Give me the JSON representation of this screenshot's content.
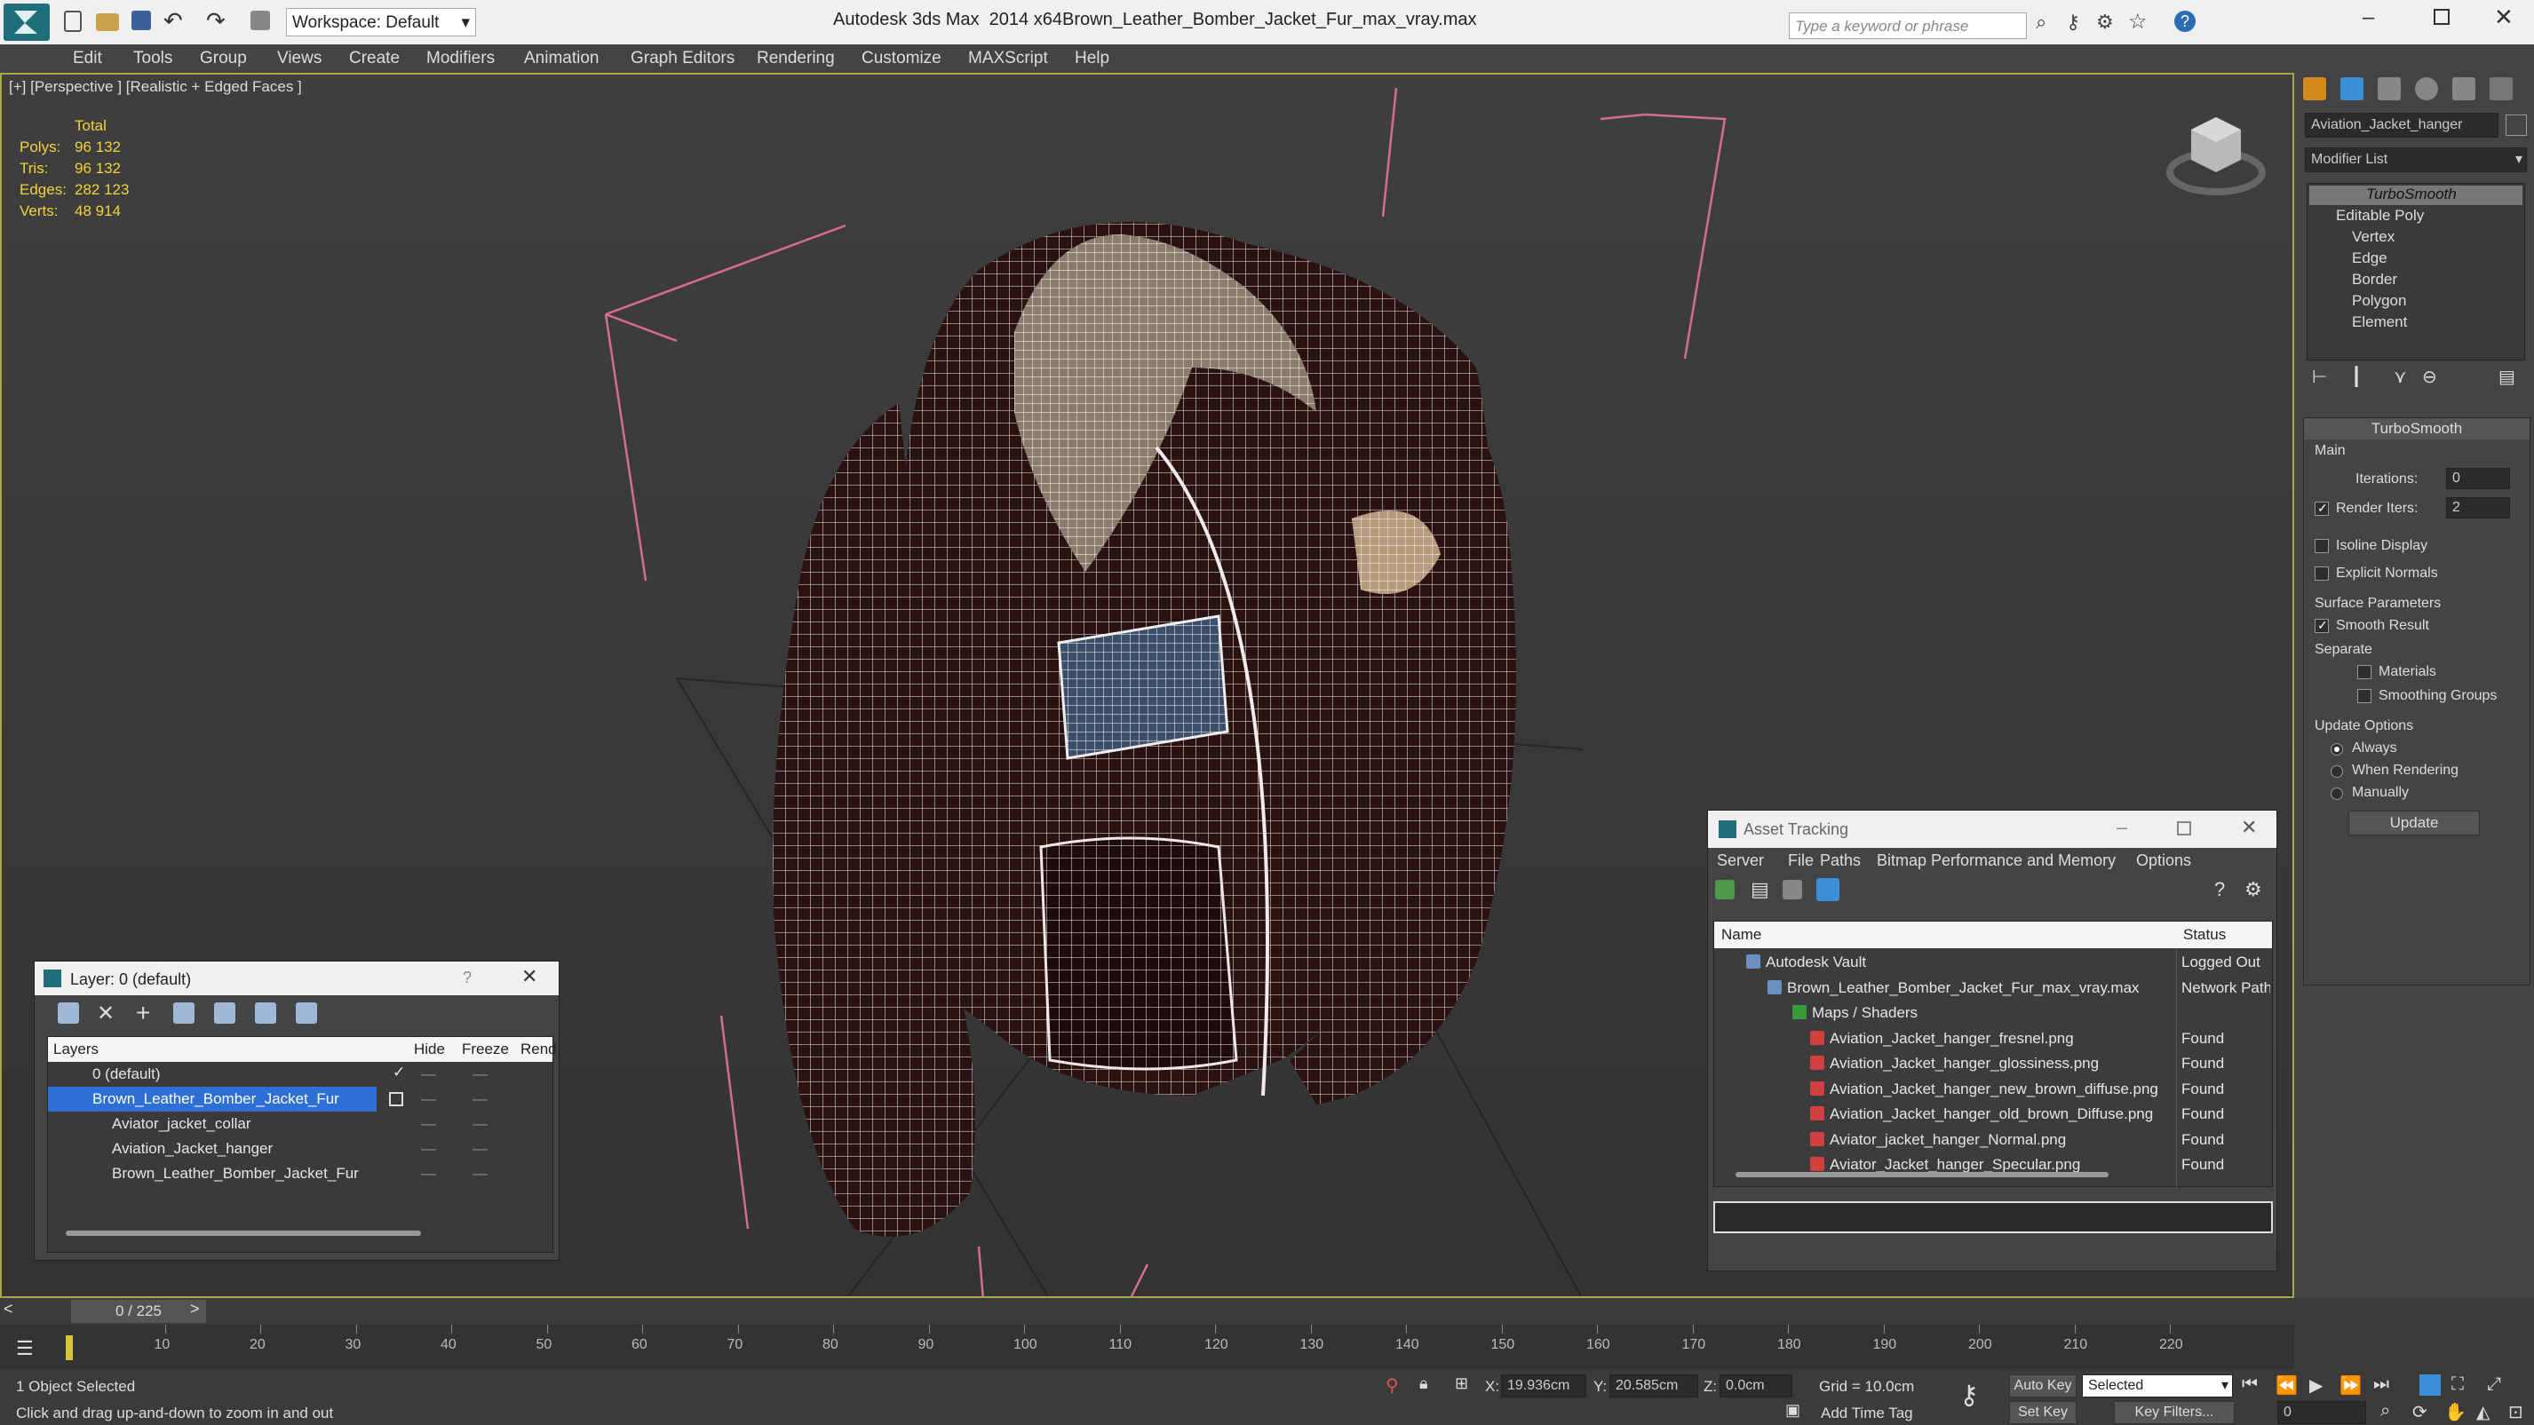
{
  "title_bar": {
    "app": "Autodesk 3ds Max  2014 x64",
    "file": "Brown_Leather_Bomber_Jacket_Fur_max_vray.max",
    "workspace": "Workspace: Default",
    "search_placeholder": "Type a keyword or phrase"
  },
  "menu": [
    "Edit",
    "Tools",
    "Group",
    "Views",
    "Create",
    "Modifiers",
    "Animation",
    "Graph Editors",
    "Rendering",
    "Customize",
    "MAXScript",
    "Help"
  ],
  "viewport": {
    "label": "[+] [Perspective ] [Realistic + Edged Faces ]",
    "stats": {
      "total_label": "Total",
      "rows": [
        {
          "k": "Polys:",
          "v": "96 132"
        },
        {
          "k": "Tris:",
          "v": "96 132"
        },
        {
          "k": "Edges:",
          "v": "282 123"
        },
        {
          "k": "Verts:",
          "v": "48 914"
        }
      ]
    }
  },
  "command_panel": {
    "object_name": "Aviation_Jacket_hanger",
    "modifier_list": "Modifier List",
    "stack": [
      "TurboSmooth",
      "Editable Poly",
      "Vertex",
      "Edge",
      "Border",
      "Polygon",
      "Element"
    ],
    "rollout_title": "TurboSmooth",
    "main_label": "Main",
    "iterations_label": "Iterations:",
    "iterations_value": "0",
    "render_iters_label": "Render Iters:",
    "render_iters_value": "2",
    "isoline": "Isoline Display",
    "explicit_normals": "Explicit Normals",
    "surface_params": "Surface Parameters",
    "smooth_result": "Smooth Result",
    "separate": "Separate",
    "materials": "Materials",
    "smoothing_groups": "Smoothing Groups",
    "update_options": "Update Options",
    "always": "Always",
    "when_rendering": "When Rendering",
    "manually": "Manually",
    "update_btn": "Update"
  },
  "layer_window": {
    "title": "Layer: 0 (default)",
    "help": "?",
    "headers": {
      "layers": "Layers",
      "hide": "Hide",
      "freeze": "Freeze",
      "render": "Rend"
    },
    "rows": [
      {
        "name": "0 (default)",
        "level": 1
      },
      {
        "name": "Brown_Leather_Bomber_Jacket_Fur",
        "level": 1
      },
      {
        "name": "Aviator_jacket_collar",
        "level": 2
      },
      {
        "name": "Aviation_Jacket_hanger",
        "level": 2
      },
      {
        "name": "Brown_Leather_Bomber_Jacket_Fur",
        "level": 2
      }
    ]
  },
  "asset_tracking": {
    "title": "Asset Tracking",
    "menu": [
      "Server",
      "File",
      "Paths",
      "Bitmap Performance and Memory",
      "Options"
    ],
    "headers": {
      "name": "Name",
      "status": "Status"
    },
    "rows": [
      {
        "name": "Autodesk Vault",
        "status": "Logged Out",
        "level": 1
      },
      {
        "name": "Brown_Leather_Bomber_Jacket_Fur_max_vray.max",
        "status": "Network Path",
        "level": 2
      },
      {
        "name": "Maps / Shaders",
        "status": "",
        "level": 3
      },
      {
        "name": "Aviation_Jacket_hanger_fresnel.png",
        "status": "Found",
        "level": 4
      },
      {
        "name": "Aviation_Jacket_hanger_glossiness.png",
        "status": "Found",
        "level": 4
      },
      {
        "name": "Aviation_Jacket_hanger_new_brown_diffuse.png",
        "status": "Found",
        "level": 4
      },
      {
        "name": "Aviation_Jacket_hanger_old_brown_Diffuse.png",
        "status": "Found",
        "level": 4
      },
      {
        "name": "Aviator_jacket_hanger_Normal.png",
        "status": "Found",
        "level": 4
      },
      {
        "name": "Aviator_Jacket_hanger_Specular.png",
        "status": "Found",
        "level": 4
      }
    ]
  },
  "timeline": {
    "frame": "0 / 225",
    "ticks": [
      "10",
      "20",
      "30",
      "40",
      "50",
      "60",
      "70",
      "80",
      "90",
      "100",
      "110",
      "120",
      "130",
      "140",
      "150",
      "160",
      "170",
      "180",
      "190",
      "200",
      "210",
      "220"
    ]
  },
  "status": {
    "selected": "1 Object Selected",
    "hint": "Click and drag up-and-down to zoom in and out",
    "x_label": "X:",
    "x": "19.936cm",
    "y_label": "Y:",
    "y": "20.585cm",
    "z_label": "Z:",
    "z": "0.0cm",
    "grid": "Grid = 10.0cm",
    "auto_key": "Auto Key",
    "selected_dd": "Selected",
    "set_key": "Set Key",
    "key_filters": "Key Filters...",
    "add_time_tag": "Add Time Tag",
    "frame_field": "0"
  },
  "colors": {
    "accent": "#3a8fd6",
    "stat_yellow": "#f2d33a",
    "viewport_border": "#a8a848",
    "selection": "#2e6fd6"
  }
}
